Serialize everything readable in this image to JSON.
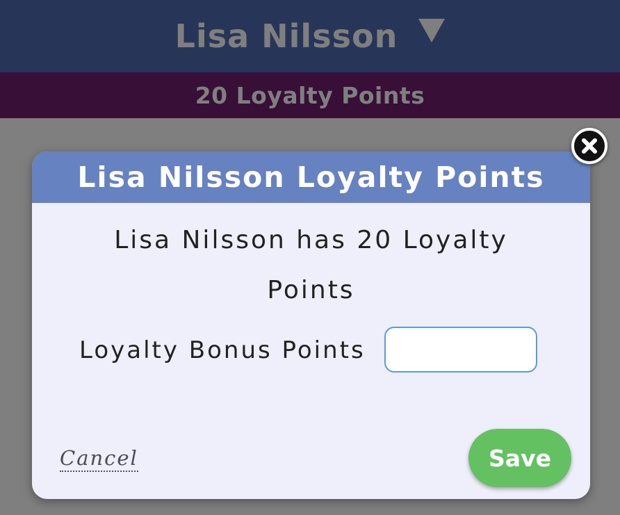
{
  "header": {
    "customer_name": "Lisa Nilsson",
    "dropdown_icon": "caret-down-icon"
  },
  "points_bar": {
    "text": "20 Loyalty Points"
  },
  "modal": {
    "title": "Lisa Nilsson Loyalty Points",
    "message": "Lisa Nilsson has 20 Loyalty Points",
    "field_label": "Loyalty Bonus Points",
    "field_value": "",
    "field_placeholder": "",
    "cancel_label": "Cancel",
    "save_label": "Save",
    "close_icon": "close-icon"
  },
  "colors": {
    "header_bg": "#4f6cb1",
    "points_bar_bg": "#6e1f6f",
    "modal_header_bg": "#6682c0",
    "modal_bg": "#efeefb",
    "save_button_bg": "#63c162",
    "input_border": "#5b9ad8"
  }
}
